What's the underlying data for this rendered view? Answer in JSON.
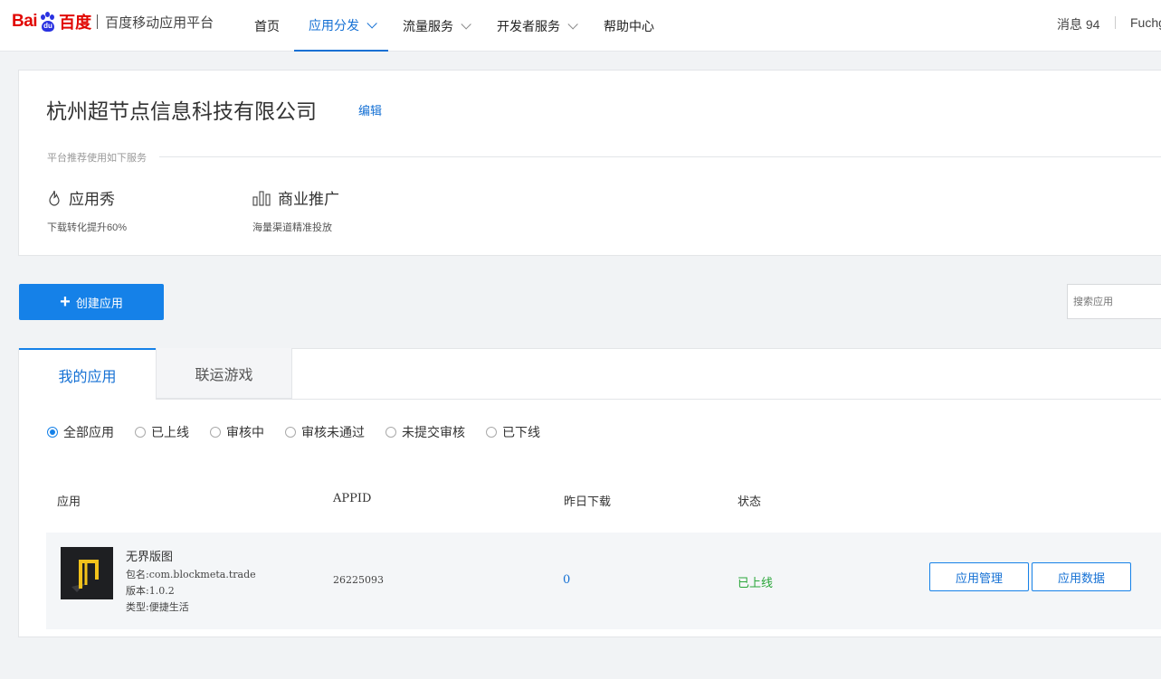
{
  "header": {
    "logo_bai": "Bai",
    "logo_du_badge": "du",
    "logo_du": "百度",
    "platform": "百度移动应用平台",
    "nav": [
      {
        "label": "首页",
        "dropdown": false,
        "active": false
      },
      {
        "label": "应用分发",
        "dropdown": true,
        "active": true
      },
      {
        "label": "流量服务",
        "dropdown": true,
        "active": false
      },
      {
        "label": "开发者服务",
        "dropdown": true,
        "active": false
      },
      {
        "label": "帮助中心",
        "dropdown": false,
        "active": false
      }
    ],
    "messages": "消息 94",
    "user": "Fuchg"
  },
  "company": {
    "name": "杭州超节点信息科技有限公司",
    "edit": "编辑",
    "recommend_label": "平台推荐使用如下服务",
    "services": [
      {
        "icon": "flame-icon",
        "title": "应用秀",
        "desc": "下载转化提升60%"
      },
      {
        "icon": "bar-chart-icon",
        "title": "商业推广",
        "desc": "海量渠道精准投放"
      }
    ]
  },
  "toolbar": {
    "create_label": "创建应用",
    "search_placeholder": "搜索应用"
  },
  "tabs": [
    {
      "label": "我的应用",
      "active": true
    },
    {
      "label": "联运游戏",
      "active": false
    }
  ],
  "filters": [
    {
      "label": "全部应用",
      "checked": true
    },
    {
      "label": "已上线",
      "checked": false
    },
    {
      "label": "审核中",
      "checked": false
    },
    {
      "label": "审核未通过",
      "checked": false
    },
    {
      "label": "未提交审核",
      "checked": false
    },
    {
      "label": "已下线",
      "checked": false
    }
  ],
  "table": {
    "headers": {
      "app": "应用",
      "appid": "APPID",
      "downloads": "昨日下载",
      "status": "状态"
    },
    "rows": [
      {
        "name": "无界版图",
        "package": "包名:com.blockmeta.trade",
        "version": "版本:1.0.2",
        "type": "类型:便捷生活",
        "appid": "26225093",
        "downloads": "0",
        "status": "已上线",
        "actions": [
          "应用管理",
          "应用数据"
        ]
      }
    ]
  },
  "colors": {
    "accent": "#1581e8",
    "link": "#1470d4",
    "online": "#2aa63a",
    "baidu_red": "#e10601",
    "baidu_blue": "#2932e1"
  }
}
